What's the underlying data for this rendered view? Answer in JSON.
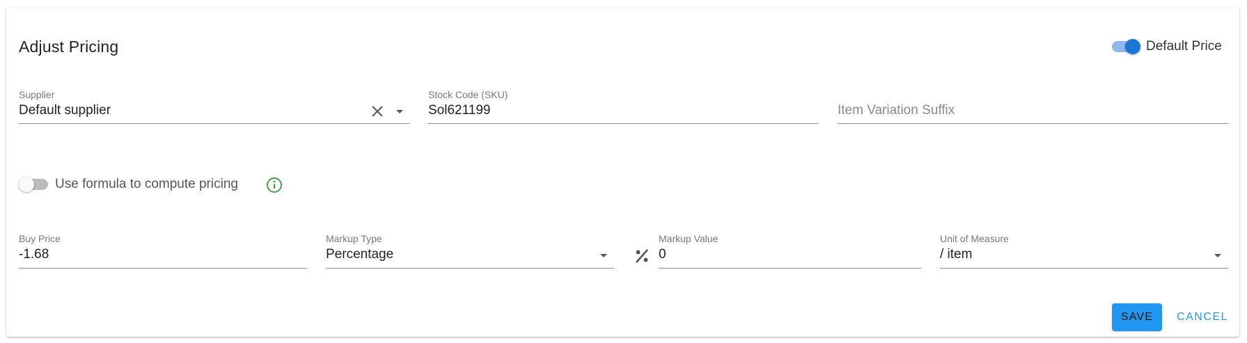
{
  "title": "Adjust Pricing",
  "default_price": {
    "label": "Default Price",
    "checked": true
  },
  "supplier": {
    "label": "Supplier",
    "value": "Default supplier"
  },
  "sku": {
    "label": "Stock Code (SKU)",
    "value": "Sol621199"
  },
  "variation_suffix": {
    "placeholder": "Item Variation Suffix"
  },
  "formula": {
    "label": "Use formula to compute pricing",
    "checked": false
  },
  "buy_price": {
    "label": "Buy Price",
    "value": "-1.68"
  },
  "markup_type": {
    "label": "Markup Type",
    "value": "Percentage"
  },
  "markup_value": {
    "label": "Markup Value",
    "value": "0"
  },
  "unit": {
    "label": "Unit of Measure",
    "value": "/ item"
  },
  "actions": {
    "save": "SAVE",
    "cancel": "CANCEL"
  },
  "colors": {
    "accent": "#1976d2",
    "button": "#2196f3",
    "info": "#43a047"
  },
  "icons": {
    "clear": "close-icon",
    "dropdown": "caret-down-icon",
    "info": "info-circle-icon",
    "percent": "percent-icon"
  }
}
